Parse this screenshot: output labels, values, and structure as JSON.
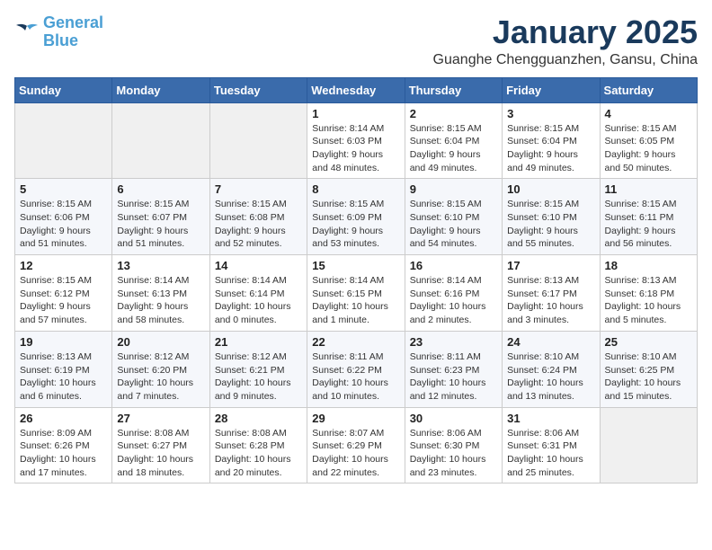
{
  "logo": {
    "line1": "General",
    "line2": "Blue"
  },
  "title": "January 2025",
  "location": "Guanghe Chengguanzhen, Gansu, China",
  "days_of_week": [
    "Sunday",
    "Monday",
    "Tuesday",
    "Wednesday",
    "Thursday",
    "Friday",
    "Saturday"
  ],
  "weeks": [
    [
      {
        "day": "",
        "info": ""
      },
      {
        "day": "",
        "info": ""
      },
      {
        "day": "",
        "info": ""
      },
      {
        "day": "1",
        "info": "Sunrise: 8:14 AM\nSunset: 6:03 PM\nDaylight: 9 hours\nand 48 minutes."
      },
      {
        "day": "2",
        "info": "Sunrise: 8:15 AM\nSunset: 6:04 PM\nDaylight: 9 hours\nand 49 minutes."
      },
      {
        "day": "3",
        "info": "Sunrise: 8:15 AM\nSunset: 6:04 PM\nDaylight: 9 hours\nand 49 minutes."
      },
      {
        "day": "4",
        "info": "Sunrise: 8:15 AM\nSunset: 6:05 PM\nDaylight: 9 hours\nand 50 minutes."
      }
    ],
    [
      {
        "day": "5",
        "info": "Sunrise: 8:15 AM\nSunset: 6:06 PM\nDaylight: 9 hours\nand 51 minutes."
      },
      {
        "day": "6",
        "info": "Sunrise: 8:15 AM\nSunset: 6:07 PM\nDaylight: 9 hours\nand 51 minutes."
      },
      {
        "day": "7",
        "info": "Sunrise: 8:15 AM\nSunset: 6:08 PM\nDaylight: 9 hours\nand 52 minutes."
      },
      {
        "day": "8",
        "info": "Sunrise: 8:15 AM\nSunset: 6:09 PM\nDaylight: 9 hours\nand 53 minutes."
      },
      {
        "day": "9",
        "info": "Sunrise: 8:15 AM\nSunset: 6:10 PM\nDaylight: 9 hours\nand 54 minutes."
      },
      {
        "day": "10",
        "info": "Sunrise: 8:15 AM\nSunset: 6:10 PM\nDaylight: 9 hours\nand 55 minutes."
      },
      {
        "day": "11",
        "info": "Sunrise: 8:15 AM\nSunset: 6:11 PM\nDaylight: 9 hours\nand 56 minutes."
      }
    ],
    [
      {
        "day": "12",
        "info": "Sunrise: 8:15 AM\nSunset: 6:12 PM\nDaylight: 9 hours\nand 57 minutes."
      },
      {
        "day": "13",
        "info": "Sunrise: 8:14 AM\nSunset: 6:13 PM\nDaylight: 9 hours\nand 58 minutes."
      },
      {
        "day": "14",
        "info": "Sunrise: 8:14 AM\nSunset: 6:14 PM\nDaylight: 10 hours\nand 0 minutes."
      },
      {
        "day": "15",
        "info": "Sunrise: 8:14 AM\nSunset: 6:15 PM\nDaylight: 10 hours\nand 1 minute."
      },
      {
        "day": "16",
        "info": "Sunrise: 8:14 AM\nSunset: 6:16 PM\nDaylight: 10 hours\nand 2 minutes."
      },
      {
        "day": "17",
        "info": "Sunrise: 8:13 AM\nSunset: 6:17 PM\nDaylight: 10 hours\nand 3 minutes."
      },
      {
        "day": "18",
        "info": "Sunrise: 8:13 AM\nSunset: 6:18 PM\nDaylight: 10 hours\nand 5 minutes."
      }
    ],
    [
      {
        "day": "19",
        "info": "Sunrise: 8:13 AM\nSunset: 6:19 PM\nDaylight: 10 hours\nand 6 minutes."
      },
      {
        "day": "20",
        "info": "Sunrise: 8:12 AM\nSunset: 6:20 PM\nDaylight: 10 hours\nand 7 minutes."
      },
      {
        "day": "21",
        "info": "Sunrise: 8:12 AM\nSunset: 6:21 PM\nDaylight: 10 hours\nand 9 minutes."
      },
      {
        "day": "22",
        "info": "Sunrise: 8:11 AM\nSunset: 6:22 PM\nDaylight: 10 hours\nand 10 minutes."
      },
      {
        "day": "23",
        "info": "Sunrise: 8:11 AM\nSunset: 6:23 PM\nDaylight: 10 hours\nand 12 minutes."
      },
      {
        "day": "24",
        "info": "Sunrise: 8:10 AM\nSunset: 6:24 PM\nDaylight: 10 hours\nand 13 minutes."
      },
      {
        "day": "25",
        "info": "Sunrise: 8:10 AM\nSunset: 6:25 PM\nDaylight: 10 hours\nand 15 minutes."
      }
    ],
    [
      {
        "day": "26",
        "info": "Sunrise: 8:09 AM\nSunset: 6:26 PM\nDaylight: 10 hours\nand 17 minutes."
      },
      {
        "day": "27",
        "info": "Sunrise: 8:08 AM\nSunset: 6:27 PM\nDaylight: 10 hours\nand 18 minutes."
      },
      {
        "day": "28",
        "info": "Sunrise: 8:08 AM\nSunset: 6:28 PM\nDaylight: 10 hours\nand 20 minutes."
      },
      {
        "day": "29",
        "info": "Sunrise: 8:07 AM\nSunset: 6:29 PM\nDaylight: 10 hours\nand 22 minutes."
      },
      {
        "day": "30",
        "info": "Sunrise: 8:06 AM\nSunset: 6:30 PM\nDaylight: 10 hours\nand 23 minutes."
      },
      {
        "day": "31",
        "info": "Sunrise: 8:06 AM\nSunset: 6:31 PM\nDaylight: 10 hours\nand 25 minutes."
      },
      {
        "day": "",
        "info": ""
      }
    ]
  ]
}
